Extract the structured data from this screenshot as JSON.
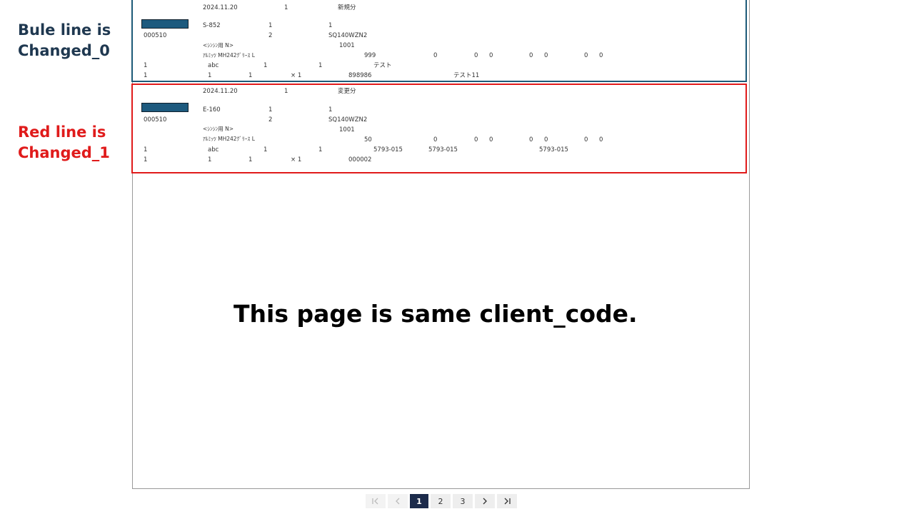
{
  "annotations": {
    "blue_label": [
      "Bule line is",
      "Changed_0"
    ],
    "red_label": [
      "Red line is",
      "Changed_1"
    ],
    "center_message": "This page is same client_code."
  },
  "records": [
    {
      "date": "2024.11.20",
      "count": "1",
      "kind": "新規分",
      "code": "S-852",
      "c1": "1",
      "c2": "1",
      "client": "000510",
      "seq": "2",
      "model": "SQ140WZN2",
      "sub": "1001",
      "line_label": "<ｼﾝｼﾝ用 N>",
      "product": "ｱﾙﾐｯﾂ MH242ｸﾞﾘｰｽ L",
      "qty": "999",
      "z1": "0",
      "z2": "0",
      "z3": "0",
      "z4": "0",
      "z5": "0",
      "z6": "0",
      "z7": "0",
      "r1": "1",
      "r2": "abc",
      "r3": "1",
      "r4": "1",
      "r5": "テスト",
      "r6": "",
      "r7": "",
      "f1": "1",
      "f2": "1",
      "f3": "1",
      "f4": "× 1",
      "f5": "898986",
      "f6": "テスト11"
    },
    {
      "date": "2024.11.20",
      "count": "1",
      "kind": "変更分",
      "code": "E-160",
      "c1": "1",
      "c2": "1",
      "client": "000510",
      "seq": "2",
      "model": "SQ140WZN2",
      "sub": "1001",
      "line_label": "<ｼﾝｼﾝ用 N>",
      "product": "ｱﾙﾐｯﾂ MH242ｸﾞﾘｰｽ L",
      "qty": "50",
      "z1": "0",
      "z2": "0",
      "z3": "0",
      "z4": "0",
      "z5": "0",
      "z6": "0",
      "z7": "0",
      "r1": "1",
      "r2": "abc",
      "r3": "1",
      "r4": "1",
      "r5": "5793-015",
      "r6": "5793-015",
      "r7": "5793-015",
      "f1": "1",
      "f2": "1",
      "f3": "1",
      "f4": "× 1",
      "f5": "000002",
      "f6": ""
    }
  ],
  "pagination": {
    "first_icon": "first-page-icon",
    "prev_icon": "prev-page-icon",
    "pages": [
      "1",
      "2",
      "3"
    ],
    "current": "1",
    "next_icon": "next-page-icon",
    "last_icon": "last-page-icon"
  },
  "colors": {
    "blue_border": "#1d5a78",
    "red_border": "#e01b1b",
    "swatch": "#1d5a7e",
    "active_page": "#1c2b4b"
  }
}
